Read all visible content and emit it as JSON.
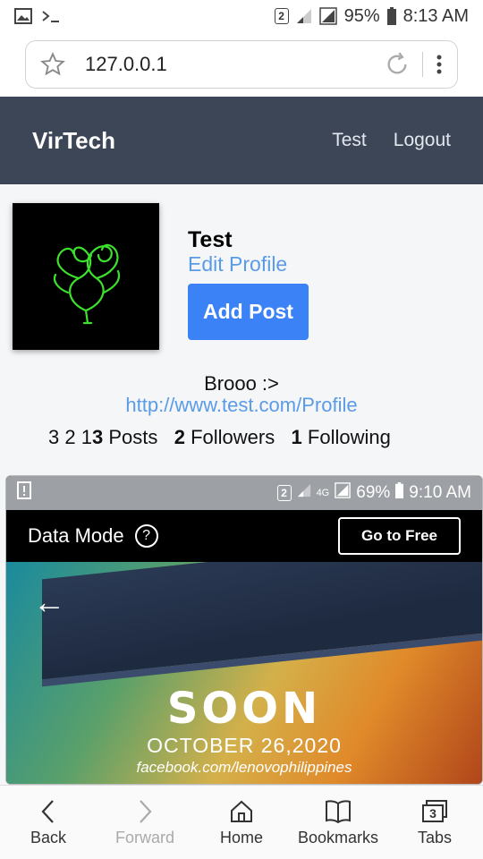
{
  "status_bar": {
    "battery": "95%",
    "time": "8:13 AM",
    "sim_slot": "2"
  },
  "browser": {
    "url": "127.0.0.1"
  },
  "site_nav": {
    "brand": "VirTech",
    "links": [
      "Test",
      "Logout"
    ]
  },
  "profile": {
    "name": "Test",
    "edit_label": "Edit Profile",
    "add_post_label": "Add Post",
    "bio": "Brooo :>",
    "website": "http://www.test.com/Profile",
    "stats_prefix": "3 2 1",
    "posts_count": "3",
    "posts_label": "Posts",
    "followers_count": "2",
    "followers_label": "Followers",
    "following_count": "1",
    "following_label": "Following"
  },
  "post": {
    "status_battery": "69%",
    "status_time": "9:10 AM",
    "status_sim_slot": "2",
    "status_network": "4G",
    "data_mode_label": "Data Mode",
    "help_icon": "?",
    "go_free_label": "Go to Free",
    "ad_headline": "SOON",
    "ad_date": "OCTOBER 26,2020",
    "ad_link": "facebook.com/lenovophilippines"
  },
  "toolbar": {
    "back": "Back",
    "forward": "Forward",
    "home": "Home",
    "bookmarks": "Bookmarks",
    "tabs": "Tabs",
    "tabs_count": "3"
  },
  "colors": {
    "nav_bg": "#3c4656",
    "link": "#5b9be6",
    "primary_button": "#3b82f6"
  }
}
